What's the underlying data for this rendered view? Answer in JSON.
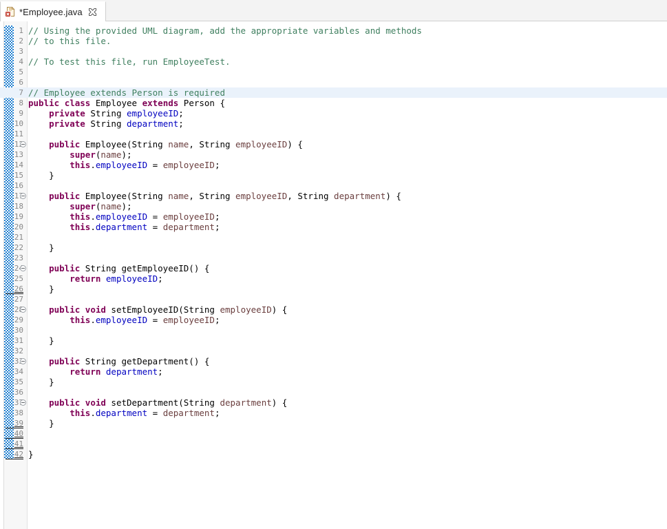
{
  "tab": {
    "label": "*Employee.java",
    "icon": "java-file-error-icon",
    "close_icon": "close-icon",
    "dirty": true
  },
  "editor": {
    "language": "Java",
    "current_line": 7,
    "colors": {
      "comment": "#3F7F5F",
      "keyword": "#7F0055",
      "field": "#0000C0",
      "local_param": "#6A3E3E",
      "plain": "#000000",
      "current_line_highlight": "#EAF2FB",
      "annotation_strip": "#1F7FD0",
      "line_number": "#888888"
    },
    "lines": [
      {
        "n": 1,
        "fold": false,
        "changed": false,
        "tokens": [
          {
            "t": "cmt",
            "s": "// Using the provided UML diagram, add the appropriate variables and methods"
          }
        ]
      },
      {
        "n": 2,
        "fold": false,
        "changed": false,
        "tokens": [
          {
            "t": "cmt",
            "s": "// to this file."
          }
        ]
      },
      {
        "n": 3,
        "fold": false,
        "changed": false,
        "tokens": []
      },
      {
        "n": 4,
        "fold": false,
        "changed": false,
        "tokens": [
          {
            "t": "cmt",
            "s": "// To test this file, run EmployeeTest."
          }
        ]
      },
      {
        "n": 5,
        "fold": false,
        "changed": false,
        "tokens": []
      },
      {
        "n": 6,
        "fold": false,
        "changed": false,
        "tokens": []
      },
      {
        "n": 7,
        "fold": false,
        "changed": false,
        "tokens": [
          {
            "t": "cmt",
            "s": "// Employee extends Person is required"
          }
        ]
      },
      {
        "n": 8,
        "fold": false,
        "changed": false,
        "tokens": [
          {
            "t": "kw",
            "s": "public"
          },
          {
            "t": "pln",
            "s": " "
          },
          {
            "t": "kw",
            "s": "class"
          },
          {
            "t": "pln",
            "s": " Employee "
          },
          {
            "t": "kw",
            "s": "extends"
          },
          {
            "t": "pln",
            "s": " Person {"
          }
        ]
      },
      {
        "n": 9,
        "fold": false,
        "changed": false,
        "tokens": [
          {
            "t": "pln",
            "s": "    "
          },
          {
            "t": "kw",
            "s": "private"
          },
          {
            "t": "pln",
            "s": " String "
          },
          {
            "t": "fld",
            "s": "employeeID"
          },
          {
            "t": "pln",
            "s": ";"
          }
        ]
      },
      {
        "n": 10,
        "fold": false,
        "changed": false,
        "tokens": [
          {
            "t": "pln",
            "s": "    "
          },
          {
            "t": "kw",
            "s": "private"
          },
          {
            "t": "pln",
            "s": " String "
          },
          {
            "t": "fld",
            "s": "department"
          },
          {
            "t": "pln",
            "s": ";"
          }
        ]
      },
      {
        "n": 11,
        "fold": false,
        "changed": false,
        "tokens": []
      },
      {
        "n": 12,
        "fold": true,
        "changed": false,
        "tokens": [
          {
            "t": "pln",
            "s": "    "
          },
          {
            "t": "kw",
            "s": "public"
          },
          {
            "t": "pln",
            "s": " Employee(String "
          },
          {
            "t": "loc",
            "s": "name"
          },
          {
            "t": "pln",
            "s": ", String "
          },
          {
            "t": "loc",
            "s": "employeeID"
          },
          {
            "t": "pln",
            "s": ") {"
          }
        ]
      },
      {
        "n": 13,
        "fold": false,
        "changed": false,
        "tokens": [
          {
            "t": "pln",
            "s": "        "
          },
          {
            "t": "kw",
            "s": "super"
          },
          {
            "t": "pln",
            "s": "("
          },
          {
            "t": "loc",
            "s": "name"
          },
          {
            "t": "pln",
            "s": ");"
          }
        ]
      },
      {
        "n": 14,
        "fold": false,
        "changed": false,
        "tokens": [
          {
            "t": "pln",
            "s": "        "
          },
          {
            "t": "kw",
            "s": "this"
          },
          {
            "t": "pln",
            "s": "."
          },
          {
            "t": "fld",
            "s": "employeeID"
          },
          {
            "t": "pln",
            "s": " = "
          },
          {
            "t": "loc",
            "s": "employeeID"
          },
          {
            "t": "pln",
            "s": ";"
          }
        ]
      },
      {
        "n": 15,
        "fold": false,
        "changed": false,
        "tokens": [
          {
            "t": "pln",
            "s": "    }"
          }
        ]
      },
      {
        "n": 16,
        "fold": false,
        "changed": false,
        "tokens": []
      },
      {
        "n": 17,
        "fold": true,
        "changed": false,
        "tokens": [
          {
            "t": "pln",
            "s": "    "
          },
          {
            "t": "kw",
            "s": "public"
          },
          {
            "t": "pln",
            "s": " Employee(String "
          },
          {
            "t": "loc",
            "s": "name"
          },
          {
            "t": "pln",
            "s": ", String "
          },
          {
            "t": "loc",
            "s": "employeeID"
          },
          {
            "t": "pln",
            "s": ", String "
          },
          {
            "t": "loc",
            "s": "department"
          },
          {
            "t": "pln",
            "s": ") {"
          }
        ]
      },
      {
        "n": 18,
        "fold": false,
        "changed": false,
        "tokens": [
          {
            "t": "pln",
            "s": "        "
          },
          {
            "t": "kw",
            "s": "super"
          },
          {
            "t": "pln",
            "s": "("
          },
          {
            "t": "loc",
            "s": "name"
          },
          {
            "t": "pln",
            "s": ");"
          }
        ]
      },
      {
        "n": 19,
        "fold": false,
        "changed": false,
        "tokens": [
          {
            "t": "pln",
            "s": "        "
          },
          {
            "t": "kw",
            "s": "this"
          },
          {
            "t": "pln",
            "s": "."
          },
          {
            "t": "fld",
            "s": "employeeID"
          },
          {
            "t": "pln",
            "s": " = "
          },
          {
            "t": "loc",
            "s": "employeeID"
          },
          {
            "t": "pln",
            "s": ";"
          }
        ]
      },
      {
        "n": 20,
        "fold": false,
        "changed": false,
        "tokens": [
          {
            "t": "pln",
            "s": "        "
          },
          {
            "t": "kw",
            "s": "this"
          },
          {
            "t": "pln",
            "s": "."
          },
          {
            "t": "fld",
            "s": "department"
          },
          {
            "t": "pln",
            "s": " = "
          },
          {
            "t": "loc",
            "s": "department"
          },
          {
            "t": "pln",
            "s": ";"
          }
        ]
      },
      {
        "n": 21,
        "fold": false,
        "changed": false,
        "tokens": []
      },
      {
        "n": 22,
        "fold": false,
        "changed": false,
        "tokens": [
          {
            "t": "pln",
            "s": "    }"
          }
        ]
      },
      {
        "n": 23,
        "fold": false,
        "changed": false,
        "tokens": []
      },
      {
        "n": 24,
        "fold": true,
        "changed": false,
        "tokens": [
          {
            "t": "pln",
            "s": "    "
          },
          {
            "t": "kw",
            "s": "public"
          },
          {
            "t": "pln",
            "s": " String getEmployeeID() {"
          }
        ]
      },
      {
        "n": 25,
        "fold": false,
        "changed": false,
        "tokens": [
          {
            "t": "pln",
            "s": "        "
          },
          {
            "t": "kw",
            "s": "return"
          },
          {
            "t": "pln",
            "s": " "
          },
          {
            "t": "fld",
            "s": "employeeID"
          },
          {
            "t": "pln",
            "s": ";"
          }
        ]
      },
      {
        "n": 26,
        "fold": false,
        "changed": true,
        "tokens": [
          {
            "t": "pln",
            "s": "    }"
          }
        ]
      },
      {
        "n": 27,
        "fold": false,
        "changed": false,
        "tokens": []
      },
      {
        "n": 28,
        "fold": true,
        "changed": false,
        "tokens": [
          {
            "t": "pln",
            "s": "    "
          },
          {
            "t": "kw",
            "s": "public"
          },
          {
            "t": "pln",
            "s": " "
          },
          {
            "t": "kw",
            "s": "void"
          },
          {
            "t": "pln",
            "s": " setEmployeeID(String "
          },
          {
            "t": "loc",
            "s": "employeeID"
          },
          {
            "t": "pln",
            "s": ") {"
          }
        ]
      },
      {
        "n": 29,
        "fold": false,
        "changed": false,
        "tokens": [
          {
            "t": "pln",
            "s": "        "
          },
          {
            "t": "kw",
            "s": "this"
          },
          {
            "t": "pln",
            "s": "."
          },
          {
            "t": "fld",
            "s": "employeeID"
          },
          {
            "t": "pln",
            "s": " = "
          },
          {
            "t": "loc",
            "s": "employeeID"
          },
          {
            "t": "pln",
            "s": ";"
          }
        ]
      },
      {
        "n": 30,
        "fold": false,
        "changed": false,
        "tokens": []
      },
      {
        "n": 31,
        "fold": false,
        "changed": false,
        "tokens": [
          {
            "t": "pln",
            "s": "    }"
          }
        ]
      },
      {
        "n": 32,
        "fold": false,
        "changed": false,
        "tokens": []
      },
      {
        "n": 33,
        "fold": true,
        "changed": false,
        "tokens": [
          {
            "t": "pln",
            "s": "    "
          },
          {
            "t": "kw",
            "s": "public"
          },
          {
            "t": "pln",
            "s": " String getDepartment() {"
          }
        ]
      },
      {
        "n": 34,
        "fold": false,
        "changed": false,
        "tokens": [
          {
            "t": "pln",
            "s": "        "
          },
          {
            "t": "kw",
            "s": "return"
          },
          {
            "t": "pln",
            "s": " "
          },
          {
            "t": "fld",
            "s": "department"
          },
          {
            "t": "pln",
            "s": ";"
          }
        ]
      },
      {
        "n": 35,
        "fold": false,
        "changed": false,
        "tokens": [
          {
            "t": "pln",
            "s": "    }"
          }
        ]
      },
      {
        "n": 36,
        "fold": false,
        "changed": false,
        "tokens": []
      },
      {
        "n": 37,
        "fold": true,
        "changed": false,
        "tokens": [
          {
            "t": "pln",
            "s": "    "
          },
          {
            "t": "kw",
            "s": "public"
          },
          {
            "t": "pln",
            "s": " "
          },
          {
            "t": "kw",
            "s": "void"
          },
          {
            "t": "pln",
            "s": " setDepartment(String "
          },
          {
            "t": "loc",
            "s": "department"
          },
          {
            "t": "pln",
            "s": ") {"
          }
        ]
      },
      {
        "n": 38,
        "fold": false,
        "changed": false,
        "tokens": [
          {
            "t": "pln",
            "s": "        "
          },
          {
            "t": "kw",
            "s": "this"
          },
          {
            "t": "pln",
            "s": "."
          },
          {
            "t": "fld",
            "s": "department"
          },
          {
            "t": "pln",
            "s": " = "
          },
          {
            "t": "loc",
            "s": "department"
          },
          {
            "t": "pln",
            "s": ";"
          }
        ]
      },
      {
        "n": 39,
        "fold": false,
        "changed": true,
        "tokens": [
          {
            "t": "pln",
            "s": "    }"
          }
        ]
      },
      {
        "n": 40,
        "fold": false,
        "changed": true,
        "tokens": []
      },
      {
        "n": 41,
        "fold": false,
        "changed": true,
        "tokens": []
      },
      {
        "n": 42,
        "fold": false,
        "changed": true,
        "tokens": [
          {
            "t": "pln",
            "s": "}"
          }
        ]
      }
    ]
  }
}
